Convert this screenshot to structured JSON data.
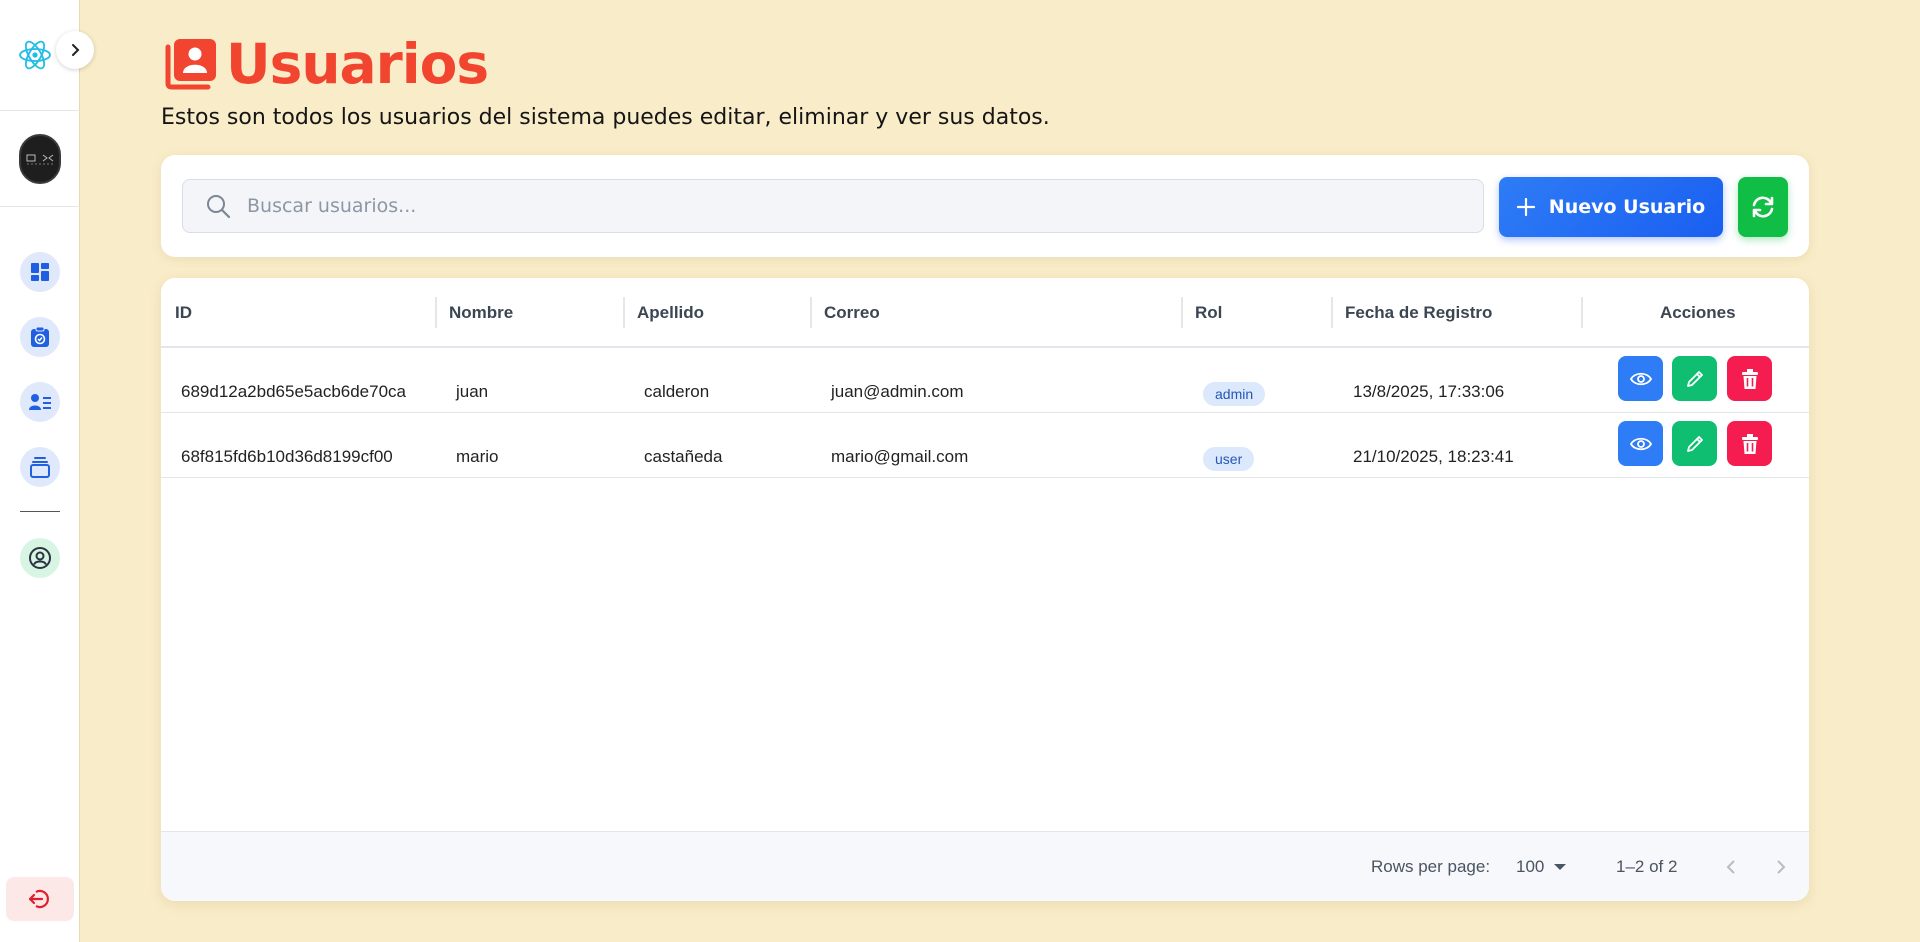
{
  "sidebar": {
    "logo_icon": "react-atom-icon",
    "toggle_icon": "chevron-right-icon",
    "nav_items": [
      {
        "icon": "dashboard-grid-icon"
      },
      {
        "icon": "clipboard-check-icon"
      },
      {
        "icon": "users-list-icon"
      },
      {
        "icon": "stacked-layers-icon"
      }
    ],
    "profile_icon": "user-circle-icon",
    "logout_icon": "logout-icon"
  },
  "header": {
    "title": "Usuarios",
    "title_icon": "user-contacts-icon",
    "subtitle": "Estos son todos los usuarios del sistema puedes editar, eliminar y ver sus datos."
  },
  "toolbar": {
    "search_placeholder": "Buscar usuarios...",
    "search_value": "",
    "new_user_label": "Nuevo Usuario",
    "refresh_icon": "refresh-icon"
  },
  "table": {
    "columns": [
      "ID",
      "Nombre",
      "Apellido",
      "Correo",
      "Rol",
      "Fecha de Registro",
      "Acciones"
    ],
    "rows": [
      {
        "id": "689d12a2bd65e5acb6de70ca",
        "nombre": "juan",
        "apellido": "calderon",
        "correo": "juan@admin.com",
        "rol": "admin",
        "fecha": "13/8/2025, 17:33:06"
      },
      {
        "id": "68f815fd6b10d36d8199cf00",
        "nombre": "mario",
        "apellido": "castañeda",
        "correo": "mario@gmail.com",
        "rol": "user",
        "fecha": "21/10/2025, 18:23:41"
      }
    ],
    "actions": [
      "eye-icon",
      "pencil-icon",
      "trash-icon"
    ]
  },
  "pagination": {
    "rows_per_page_label": "Rows per page:",
    "rows_per_page_value": "100",
    "range_label": "1–2 of 2"
  },
  "colors": {
    "page_bg": "#f9ecc8",
    "title": "#f2452f",
    "primary": "#2e7cf6",
    "success": "#10bd45",
    "edit": "#10be72",
    "danger": "#f51d4f"
  }
}
